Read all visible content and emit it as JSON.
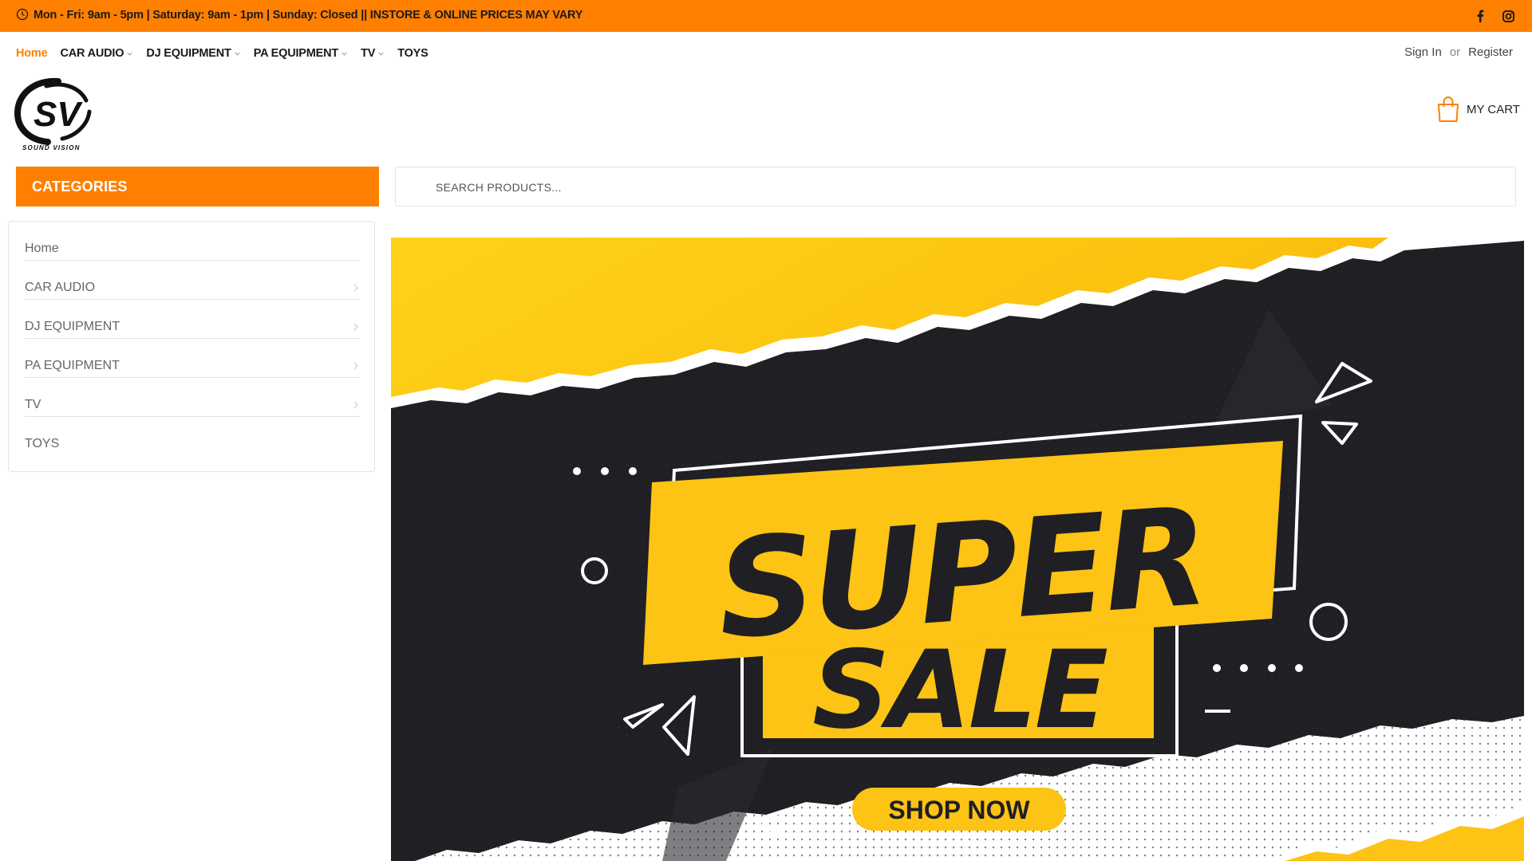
{
  "topbar": {
    "hours_text": "Mon - Fri: 9am - 5pm | Saturday: 9am - 1pm | Sunday: Closed || INSTORE & ONLINE PRICES MAY VARY",
    "icons": [
      "clock-icon",
      "facebook-icon",
      "instagram-icon"
    ],
    "background": "#ff7f00"
  },
  "nav": {
    "items": [
      {
        "label": "Home",
        "active": true,
        "has_dropdown": false
      },
      {
        "label": "CAR AUDIO",
        "active": false,
        "has_dropdown": true
      },
      {
        "label": "DJ EQUIPMENT",
        "active": false,
        "has_dropdown": true
      },
      {
        "label": "PA EQUIPMENT",
        "active": false,
        "has_dropdown": true
      },
      {
        "label": "TV",
        "active": false,
        "has_dropdown": true
      },
      {
        "label": "TOYS",
        "active": false,
        "has_dropdown": false
      }
    ]
  },
  "account": {
    "sign_in": "Sign In",
    "or": "or",
    "register": "Register"
  },
  "logo": {
    "letters": "SV",
    "tagline": "SOUND VISION"
  },
  "cart": {
    "label": "MY CART",
    "icon": "shopping-bag-icon"
  },
  "categories": {
    "header": "CATEGORIES",
    "items": [
      {
        "label": "Home",
        "has_submenu": false
      },
      {
        "label": "CAR AUDIO",
        "has_submenu": true
      },
      {
        "label": "DJ EQUIPMENT",
        "has_submenu": true
      },
      {
        "label": "PA EQUIPMENT",
        "has_submenu": true
      },
      {
        "label": "TV",
        "has_submenu": true
      },
      {
        "label": "TOYS",
        "has_submenu": false
      }
    ]
  },
  "search": {
    "placeholder": "SEARCH PRODUCTS..."
  },
  "banner": {
    "headline_1": "SUPER",
    "headline_2": "SALE",
    "cta": "SHOP NOW",
    "colors": {
      "yellow": "#fdc315",
      "dark": "#1f1f24",
      "accent": "#ff7f00"
    }
  }
}
